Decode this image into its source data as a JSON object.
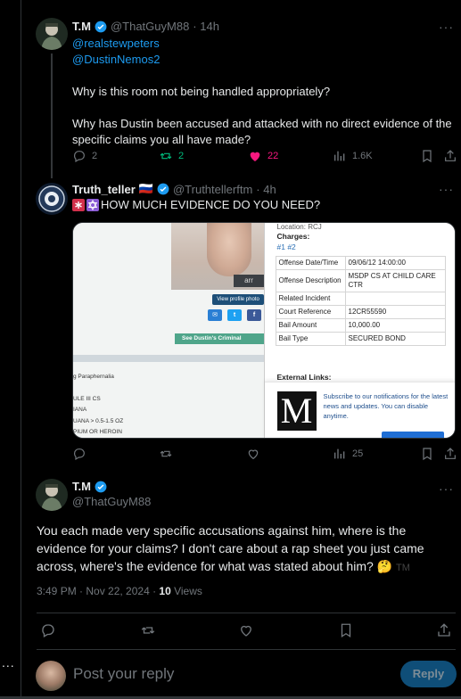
{
  "left_rail": {
    "more": "..."
  },
  "tweet1": {
    "name": "T.M",
    "handle": "@ThatGuyM88",
    "time": "· 14h",
    "more": "···",
    "mentions": [
      "@realstewpeters",
      "@DustinNemos2"
    ],
    "paragraph1": "Why is this room not being handled appropriately?",
    "paragraph2": "Why has Dustin been accused and attacked with no direct evidence of the specific claims you all have made?",
    "replies": "2",
    "reposts": "2",
    "likes": "22",
    "views": "1.6K"
  },
  "tweet2": {
    "name": "Truth_teller",
    "flag": "🇷🇺",
    "handle": "@Truthtellerftm",
    "time": "· 4h",
    "more": "···",
    "text": "HOW MUCH EVIDENCE DO YOU NEED?",
    "views": "25",
    "media": {
      "left": {
        "photo_tag": "arr",
        "view_profile": "View profile photo",
        "share_letters": [
          "✉",
          "t",
          "f"
        ],
        "criminal_bar": "See Dustin's Criminal",
        "list": [
          "g Paraphernalia",
          "",
          "ULE III CS",
          "IANA",
          "UANA > 0.5-1.5 OZ",
          "PIUM OR HEROIN"
        ]
      },
      "right": {
        "location": "Location: RCJ",
        "charges_label": "Charges:",
        "charge_links": "#1 #2",
        "table": [
          [
            "Offense Date/Time",
            "09/06/12 14:00:00"
          ],
          [
            "Offense Description",
            "MSDP CS AT CHILD CARE CTR"
          ],
          [
            "Related Incident",
            ""
          ],
          [
            "Court Reference",
            "12CR55590"
          ],
          [
            "Bail Amount",
            "10,000.00"
          ],
          [
            "Bail Type",
            "SECURED BOND"
          ]
        ],
        "external_links": "External Links:",
        "logo_letter": "M",
        "notice": "Subscribe to our notifications for the latest news and updates. You can disable anytime."
      }
    }
  },
  "main_tweet": {
    "name": "T.M",
    "handle": "@ThatGuyM88",
    "more": "···",
    "text": "You each made very specific accusations against him, where is the evidence for your claims? I don't care about a rap sheet you just came across, where's the evidence for what was stated about him? 🤔",
    "tm_mark": "TM",
    "time": "3:49 PM · Nov 22, 2024 · ",
    "views_count": "10",
    "views_label": " Views"
  },
  "reply_box": {
    "placeholder": "Post your reply",
    "button": "Reply"
  },
  "colors": {
    "accent": "#1d9bf0",
    "like": "#f91880",
    "repost": "#00ba7c",
    "muted": "#71767b"
  }
}
